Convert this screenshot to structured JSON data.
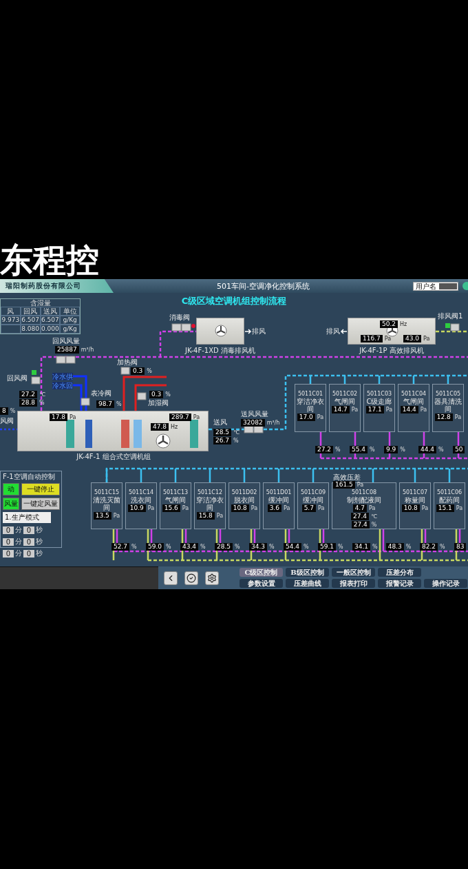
{
  "caption": "东程控",
  "header": {
    "company": "瑞阳制药股份有限公司",
    "title": "501车间-空调净化控制系统",
    "user_label": "用户名"
  },
  "subtitle": "C级区域空调机组控制流程",
  "humidity_table": {
    "title": "含湿量",
    "columns": [
      "风",
      "回风",
      "送风",
      "单位"
    ],
    "rows": [
      {
        "cells": [
          "9.973",
          "6.507",
          "6.507",
          "g/Kg"
        ]
      },
      {
        "cells": [
          "",
          "8.080",
          "0.000",
          "g/Kg"
        ]
      }
    ]
  },
  "labels": [
    {
      "text": "消毒阀",
      "kind": "plain"
    },
    {
      "text": "排风",
      "kind": "plain"
    },
    {
      "text": "排风",
      "kind": "plain"
    },
    {
      "text": "排风阀1",
      "kind": "plain"
    },
    {
      "text": "回风风量",
      "kind": "plain"
    },
    {
      "text": "回风阀",
      "kind": "plain"
    },
    {
      "text": "冷水供",
      "kind": "water"
    },
    {
      "text": "冷水回",
      "kind": "water"
    },
    {
      "text": "表冷阀",
      "kind": "plain"
    },
    {
      "text": "加热阀",
      "kind": "plain"
    },
    {
      "text": "加湿阀",
      "kind": "plain"
    },
    {
      "text": "风阀",
      "kind": "plain"
    },
    {
      "text": "送风",
      "kind": "plain"
    },
    {
      "text": "送风风量",
      "kind": "plain"
    }
  ],
  "readouts": [
    {
      "value": "25887",
      "unit": "m³/h"
    },
    {
      "value": "0.3",
      "unit": "%"
    },
    {
      "value": "27.2",
      "unit": "℃"
    },
    {
      "value": "28.8",
      "unit": "%"
    },
    {
      "value": "98.7",
      "unit": "%"
    },
    {
      "value": "0.3",
      "unit": "%"
    },
    {
      "value": "8",
      "unit": "%"
    },
    {
      "value": "28.5",
      "unit": "℃"
    },
    {
      "value": "26.7",
      "unit": "%"
    },
    {
      "value": "32082",
      "unit": "m³/h"
    }
  ],
  "air_handler": {
    "name": "JK-4F-1 组合式空调机组",
    "readouts": [
      {
        "value": "17.8",
        "unit": "Pa"
      },
      {
        "value": "289.7",
        "unit": "Pa"
      },
      {
        "value": "47.8",
        "unit": "Hz"
      }
    ]
  },
  "exhaust_fans": [
    {
      "name": "JK-4F-1XD 消毒排风机"
    },
    {
      "name": "JK-4F-1P 高效排风机",
      "readouts": [
        {
          "value": "50.2",
          "unit": "Hz"
        },
        {
          "value": "116.7",
          "unit": "Pa"
        },
        {
          "value": "43.0",
          "unit": "Pa"
        }
      ]
    }
  ],
  "rooms_top": [
    {
      "code": "5011C01",
      "name": "穿洁净衣间",
      "readings": [
        {
          "value": "17.0",
          "unit": "Pa"
        }
      ],
      "valves": [
        {
          "value": "27.2",
          "unit": "%"
        }
      ]
    },
    {
      "code": "5011C02",
      "name": "气闸间",
      "readings": [
        {
          "value": "14.7",
          "unit": "Pa"
        }
      ],
      "valves": [
        {
          "value": "55.4",
          "unit": "%"
        }
      ]
    },
    {
      "code": "5011C03",
      "name": "C级走廊",
      "readings": [
        {
          "value": "17.1",
          "unit": "Pa"
        }
      ],
      "valves": [
        {
          "value": "9.9",
          "unit": "%"
        }
      ]
    },
    {
      "code": "5011C04",
      "name": "气闸间",
      "readings": [
        {
          "value": "14.4",
          "unit": "Pa"
        }
      ],
      "valves": [
        {
          "value": "44.4",
          "unit": "%"
        }
      ]
    },
    {
      "code": "5011C05",
      "name": "器具清洗间",
      "readings": [
        {
          "value": "12.8",
          "unit": "Pa"
        }
      ],
      "valves": [
        {
          "value": "50"
        }
      ]
    }
  ],
  "rooms_bottom": [
    {
      "code": "5011C15",
      "name": "清洗灭菌间",
      "kind": "normal",
      "readings": [
        {
          "value": "13.5",
          "unit": "Pa"
        }
      ],
      "valves": [
        {
          "value": "52.7",
          "unit": "%"
        }
      ]
    },
    {
      "code": "5011C14",
      "name": "洗衣间",
      "kind": "normal",
      "readings": [
        {
          "value": "10.9",
          "unit": "Pa"
        }
      ],
      "valves": [
        {
          "value": "59.0",
          "unit": "%"
        }
      ]
    },
    {
      "code": "5011C13",
      "name": "气闸间",
      "kind": "normal",
      "readings": [
        {
          "value": "15.6",
          "unit": "Pa"
        }
      ],
      "valves": [
        {
          "value": "43.4",
          "unit": "%"
        }
      ]
    },
    {
      "code": "5011C12",
      "name": "穿洁净衣间",
      "kind": "normal",
      "readings": [
        {
          "value": "15.8",
          "unit": "Pa"
        }
      ],
      "valves": [
        {
          "value": "28.5",
          "unit": "%"
        }
      ]
    },
    {
      "code": "5011D02",
      "name": "脱衣间",
      "kind": "normal",
      "readings": [
        {
          "value": "10.8",
          "unit": "Pa"
        }
      ],
      "valves": [
        {
          "value": "34.3",
          "unit": "%"
        }
      ]
    },
    {
      "code": "5011D01",
      "name": "缓冲间",
      "kind": "normal",
      "readings": [
        {
          "value": "3.6",
          "unit": "Pa"
        }
      ],
      "valves": [
        {
          "value": "54.4",
          "unit": "%"
        }
      ]
    },
    {
      "code": "5011C09",
      "name": "缓冲间",
      "kind": "normal",
      "readings": [
        {
          "value": "5.7",
          "unit": "Pa"
        }
      ],
      "valves": [
        {
          "value": "59.1",
          "unit": "%"
        }
      ]
    },
    {
      "code": "5011C08",
      "name": "制剂配液间",
      "kind": "wide",
      "filter": {
        "label": "高效压差",
        "value": "161.5",
        "unit": "Pa"
      },
      "readings": [
        {
          "value": "4.7",
          "unit": "Pa"
        },
        {
          "value": "27.4",
          "unit": "℃"
        },
        {
          "value": "27.4",
          "unit": "%"
        }
      ],
      "valves": [
        {
          "value": "34.1",
          "unit": "%"
        },
        {
          "value": "48.3",
          "unit": "%"
        }
      ]
    },
    {
      "code": "5011C07",
      "name": "称量间",
      "kind": "normal",
      "readings": [
        {
          "value": "10.8",
          "unit": "Pa"
        }
      ],
      "valves": [
        {
          "value": "82.2",
          "unit": "%"
        }
      ]
    },
    {
      "code": "5011C06",
      "name": "配药间",
      "kind": "normal",
      "readings": [
        {
          "value": "15.1",
          "unit": "Pa"
        }
      ],
      "valves": [
        {
          "value": "83"
        }
      ]
    }
  ],
  "control_panel": {
    "title": "F-1空调自动控制",
    "buttons": [
      {
        "label": "动",
        "color": "#22dd33"
      },
      {
        "label": "一键停止",
        "color": "#dddd22"
      },
      {
        "label": "风量",
        "color": "#22dd33"
      },
      {
        "label": "一键定风量",
        "color": "#c8c8c8"
      }
    ],
    "mode": "1.生产模式",
    "timers": [
      {
        "min": "0",
        "min_unit": "分",
        "sec": "0",
        "sec_unit": "秒"
      },
      {
        "min": "0",
        "min_unit": "分",
        "sec": "0",
        "sec_unit": "秒"
      },
      {
        "min": "0",
        "min_unit": "分",
        "sec": "0",
        "sec_unit": "秒"
      }
    ]
  },
  "nav": [
    {
      "label": "C级区控制",
      "selected": true
    },
    {
      "label": "B级区控制",
      "selected": false
    },
    {
      "label": "一般区控制",
      "selected": false
    },
    {
      "label": "压差分布",
      "selected": false
    },
    {
      "label": "参数设置",
      "selected": false
    },
    {
      "label": "压差曲线",
      "selected": false
    },
    {
      "label": "报表打印",
      "selected": false
    },
    {
      "label": "报警记录",
      "selected": false
    },
    {
      "label": "操作记录",
      "selected": false
    }
  ]
}
